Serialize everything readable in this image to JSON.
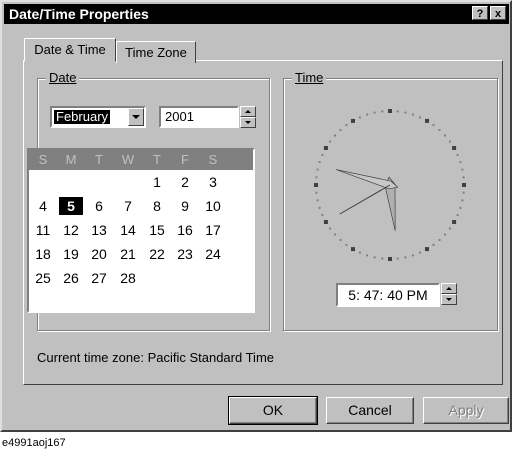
{
  "window": {
    "title": "Date/Time Properties",
    "help_button": "?",
    "close_button": "x"
  },
  "tabs": [
    {
      "label": "Date & Time",
      "active": true
    },
    {
      "label": "Time Zone",
      "active": false
    }
  ],
  "date_group": {
    "label": "Date",
    "month": "February",
    "year": "2001",
    "weekday_headers": [
      "S",
      "M",
      "T",
      "W",
      "T",
      "F",
      "S"
    ],
    "weeks": [
      [
        "",
        "",
        "",
        "",
        "1",
        "2",
        "3"
      ],
      [
        "4",
        "5",
        "6",
        "7",
        "8",
        "9",
        "10"
      ],
      [
        "11",
        "12",
        "13",
        "14",
        "15",
        "16",
        "17"
      ],
      [
        "18",
        "19",
        "20",
        "21",
        "22",
        "23",
        "24"
      ],
      [
        "25",
        "26",
        "27",
        "28",
        "",
        "",
        ""
      ]
    ],
    "selected_day": "5"
  },
  "time_group": {
    "label": "Time",
    "time_value": "5: 47: 40 PM",
    "clock": {
      "hour": 5,
      "minute": 47,
      "second": 40
    }
  },
  "current_time_zone": {
    "label": "Current time zone:",
    "value": "Pacific Standard Time"
  },
  "buttons": {
    "ok": "OK",
    "cancel": "Cancel",
    "apply": "Apply"
  },
  "caption": "e4991aoj167",
  "colors": {
    "face": "#c0c0c0",
    "shadow": "#808080",
    "titlebar": "#000000"
  }
}
